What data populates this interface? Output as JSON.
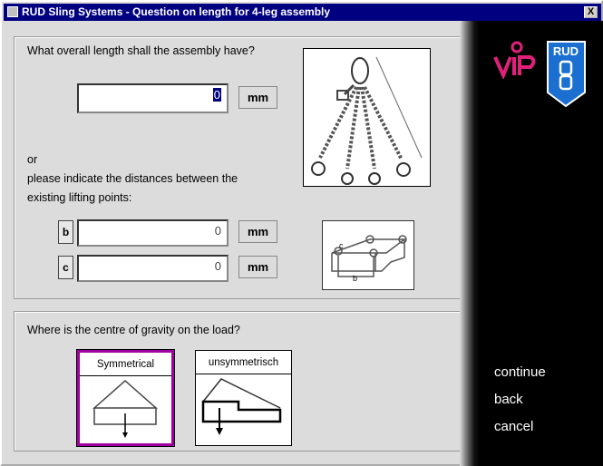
{
  "window": {
    "title": "RUD Sling Systems - Question on length for 4-leg assembly",
    "close_label": "X"
  },
  "length": {
    "question": "What overall length shall the assembly have?",
    "value": "0",
    "unit": "mm"
  },
  "distances": {
    "or": "or",
    "prompt_line1": "please indicate the distances between the",
    "prompt_line2": "existing lifting points:",
    "b": {
      "label": "b",
      "value": "0",
      "unit": "mm"
    },
    "c": {
      "label": "c",
      "value": "0",
      "unit": "mm"
    }
  },
  "gravity": {
    "question": "Where is the centre of gravity on the load?",
    "options": [
      {
        "label": "Symmetrical",
        "selected": true
      },
      {
        "label": "unsymmetrisch",
        "selected": false
      }
    ],
    "selected_color": "#a000a0"
  },
  "logos": {
    "vip": "ViP",
    "rud": "RUD",
    "vip_color": "#e0207a",
    "rud_color": "#1a6fd0"
  },
  "nav": {
    "continue": "continue",
    "back": "back",
    "cancel": "cancel"
  }
}
